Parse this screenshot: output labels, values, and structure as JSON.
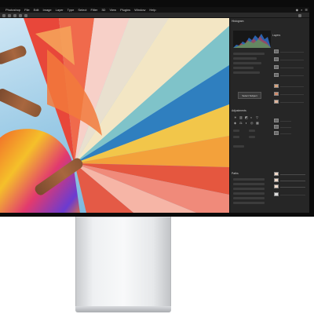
{
  "menubar": {
    "app": "Photoshop",
    "items": [
      "File",
      "Edit",
      "Image",
      "Layer",
      "Type",
      "Select",
      "Filter",
      "3D",
      "View",
      "Plugins",
      "Window",
      "Help"
    ],
    "status": [
      "◉",
      "⌕",
      "☰"
    ]
  },
  "panels": {
    "histogram_title": "Histogram",
    "adjustments_title": "Adjustments",
    "layers_title": "Layers",
    "paths_title": "Paths",
    "button_label": "Select Subject"
  },
  "colors": {
    "screen_bg": "#1f1f1f",
    "panel_bg": "#262626",
    "bezel": "#0b0b0b",
    "stand": "#eef0f2"
  },
  "icons": [
    "apple-icon",
    "search-icon",
    "menu-icon",
    "eye-icon",
    "layer-thumbnail-icon"
  ]
}
